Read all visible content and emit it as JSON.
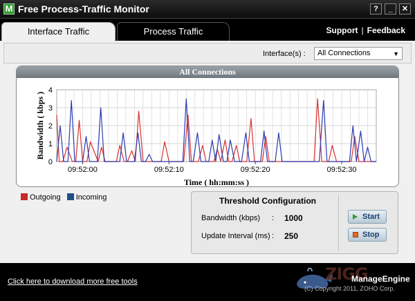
{
  "window": {
    "icon_letter": "M",
    "title": "Free Process-Traffic Monitor",
    "help_btn": "?",
    "min_btn": "_",
    "close_btn": "✕"
  },
  "tabs": [
    {
      "label": "Interface Traffic",
      "active": true
    },
    {
      "label": "Process Traffic",
      "active": false
    }
  ],
  "links": {
    "support": "Support",
    "separator": "|",
    "feedback": "Feedback"
  },
  "interface": {
    "label": "Interface(s) :",
    "selected": "All Connections"
  },
  "chart_panel_title": "All Connections",
  "chart_data": {
    "type": "line",
    "title": "All Connections",
    "xlabel": "Time ( hh:mm:ss )",
    "ylabel": "Bandwidth ( kbps )",
    "ylim": [
      0,
      4
    ],
    "yticks": [
      "0",
      "1",
      "2",
      "3",
      "4"
    ],
    "xticks": [
      {
        "label": "09:52:00",
        "t": 3
      },
      {
        "label": "09:52:10",
        "t": 13
      },
      {
        "label": "09:52:20",
        "t": 23
      },
      {
        "label": "09:52:30",
        "t": 33
      }
    ],
    "x_range": [
      0,
      37
    ],
    "grid": true,
    "colors": {
      "outgoing": "#d93030",
      "incoming": "#2a3ab0"
    },
    "series": [
      {
        "name": "Outgoing",
        "x": [
          0,
          0.3,
          0.7,
          1.2,
          1.8,
          2.2,
          2.6,
          3.0,
          3.5,
          3.9,
          4.3,
          4.8,
          5.2,
          5.6,
          6.1,
          6.5,
          6.9,
          7.3,
          7.8,
          8.2,
          8.7,
          9.1,
          9.5,
          10.0,
          10.4,
          10.8,
          11.2,
          11.7,
          12.1,
          12.5,
          13.0,
          13.4,
          13.8,
          14.3,
          14.7,
          15.2,
          15.6,
          16.0,
          16.4,
          16.9,
          17.3,
          17.7,
          18.2,
          18.6,
          19.0,
          19.5,
          19.9,
          20.3,
          20.8,
          21.2,
          21.6,
          22.0,
          22.5,
          22.9,
          23.3,
          23.8,
          24.2,
          24.6,
          25.1,
          25.5,
          25.9,
          26.4,
          26.8,
          27.2,
          27.6,
          28.1,
          28.5,
          28.9,
          29.4,
          29.8,
          30.2,
          30.7,
          31.1,
          31.5,
          31.9,
          32.4,
          32.8,
          33.2,
          33.7,
          34.1,
          34.5,
          35.0,
          35.4,
          35.8,
          36.2,
          36.7,
          37.0
        ],
        "values": [
          2.6,
          0,
          0,
          0.8,
          0,
          0,
          2.3,
          0,
          0,
          1.1,
          0.6,
          0,
          0.8,
          0,
          0,
          0,
          0,
          0.9,
          0,
          0,
          0.6,
          0,
          2.8,
          0,
          0,
          0,
          0,
          0,
          0,
          1.1,
          0,
          0,
          0,
          0,
          0,
          2.6,
          0,
          0,
          0,
          0.9,
          0,
          0,
          0,
          0.7,
          0,
          1.2,
          0,
          0,
          0.9,
          0,
          0,
          0,
          2.4,
          0,
          0,
          0,
          1.4,
          0,
          0,
          0,
          0,
          0,
          0,
          0,
          0,
          0,
          0,
          0,
          0,
          0,
          3.5,
          0,
          0,
          0,
          0.9,
          0,
          0,
          0,
          0,
          0,
          1.4,
          0,
          0,
          0,
          0,
          0,
          0
        ]
      },
      {
        "name": "Incoming",
        "x": [
          0,
          0.4,
          0.8,
          1.3,
          1.7,
          2.1,
          2.5,
          3.0,
          3.4,
          3.8,
          4.2,
          4.7,
          5.1,
          5.5,
          6.0,
          6.4,
          6.8,
          7.3,
          7.7,
          8.1,
          8.6,
          9.0,
          9.4,
          9.8,
          10.3,
          10.7,
          11.1,
          11.5,
          12.0,
          12.4,
          12.8,
          13.3,
          13.7,
          14.1,
          14.6,
          15.0,
          15.4,
          15.8,
          16.3,
          16.7,
          17.1,
          17.6,
          18.0,
          18.4,
          18.8,
          19.3,
          19.7,
          20.1,
          20.6,
          21.0,
          21.4,
          21.9,
          22.3,
          22.7,
          23.1,
          23.6,
          24.0,
          24.4,
          24.9,
          25.3,
          25.7,
          26.1,
          26.6,
          27.0,
          27.4,
          27.9,
          28.3,
          28.7,
          29.1,
          29.6,
          30.0,
          30.4,
          30.9,
          31.3,
          31.7,
          32.2,
          32.6,
          33.0,
          33.5,
          33.9,
          34.3,
          34.7,
          35.2,
          35.6,
          36.0,
          36.4,
          37.0
        ],
        "values": [
          0,
          2.0,
          0,
          0,
          3.4,
          0,
          0,
          0,
          1.4,
          0,
          0,
          0,
          3.0,
          0,
          0,
          0,
          0,
          0,
          1.6,
          0,
          0,
          0,
          1.6,
          0,
          0,
          0.4,
          0,
          0,
          0,
          0,
          0,
          0,
          0,
          0,
          0,
          3.5,
          0,
          0,
          1.6,
          0,
          0,
          0,
          1.2,
          0,
          1.5,
          0,
          0,
          1.2,
          0,
          0,
          0,
          1.6,
          0,
          0,
          0,
          0,
          1.7,
          0,
          0,
          0,
          1.6,
          0,
          0,
          0,
          0,
          0,
          0,
          0,
          0,
          0,
          0,
          0,
          3.4,
          0,
          0,
          0,
          0,
          0,
          0,
          0,
          2.0,
          0,
          1.7,
          0,
          0.8,
          0,
          0
        ]
      }
    ]
  },
  "legend": [
    {
      "label": "Outgoing",
      "color": "#d93030"
    },
    {
      "label": "Incoming",
      "color": "#2a3ab0"
    }
  ],
  "threshold": {
    "title": "Threshold Configuration",
    "bandwidth_label": "Bandwidth (kbps)",
    "bandwidth_value": "1000",
    "interval_label": "Update Interval (ms)",
    "interval_value": "250",
    "colon": ":",
    "start_label": "Start",
    "stop_label": "Stop"
  },
  "footer": {
    "download_link": "Click here to download more free tools",
    "brand": "ManageEngine",
    "copyright": "(C) Copyright 2011, ZOHO Corp.",
    "watermark": "ZIGG"
  }
}
